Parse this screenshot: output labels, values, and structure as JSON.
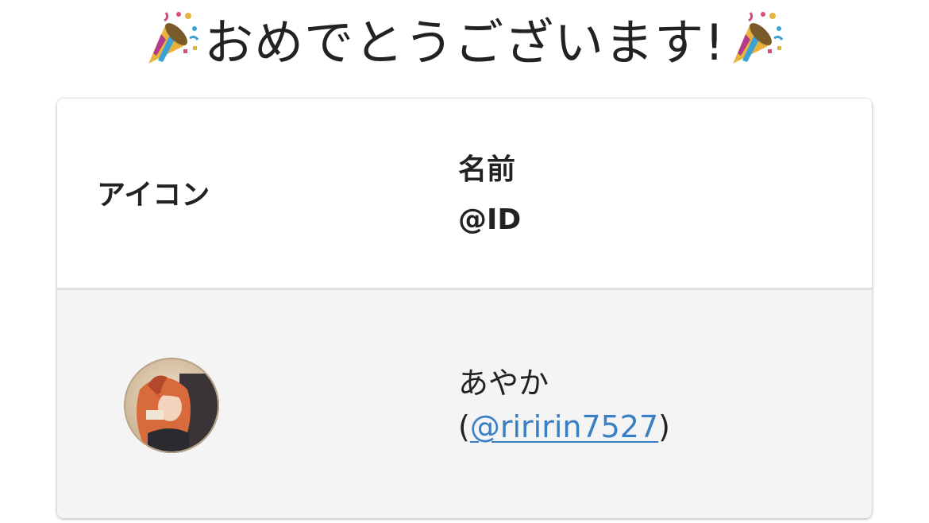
{
  "title": {
    "text": "おめでとうございます!",
    "left_icon": "party-popper-icon",
    "right_icon": "party-popper-icon"
  },
  "table": {
    "headers": {
      "icon": "アイコン",
      "name": "名前",
      "id": "@ID"
    },
    "rows": [
      {
        "avatar": "user-avatar",
        "name": "あやか",
        "handle_open": "(",
        "handle": "@riririn7527",
        "handle_close": ")"
      }
    ]
  },
  "colors": {
    "link": "#3a7fc4",
    "header_bg": "#ffffff",
    "row_bg": "#f4f4f4"
  }
}
